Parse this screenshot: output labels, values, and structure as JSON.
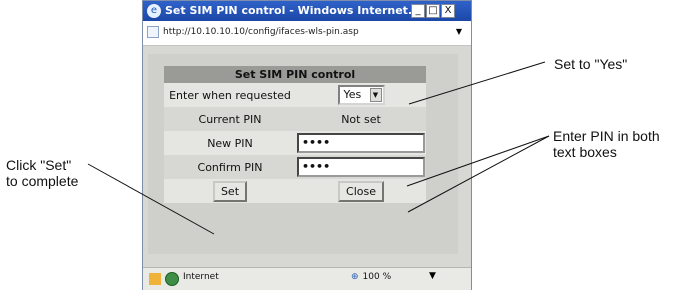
{
  "window": {
    "title": "Set SIM PIN control - Windows Internet...",
    "controls": {
      "minimize": "_",
      "maximize": "□",
      "close": "X"
    }
  },
  "address_bar": {
    "url": "http://10.10.10.10/config/ifaces-wls-pin.asp",
    "dropdown": "▼"
  },
  "form": {
    "title": "Set SIM PIN control",
    "rows": {
      "enter_when_requested": {
        "label": "Enter when requested",
        "value": "Yes"
      },
      "current_pin": {
        "label": "Current PIN",
        "value": "Not set"
      },
      "new_pin": {
        "label": "New PIN",
        "value": "••••"
      },
      "confirm_pin": {
        "label": "Confirm PIN",
        "value": "••••"
      }
    },
    "buttons": {
      "set": "Set",
      "close": "Close"
    }
  },
  "status_bar": {
    "zone": "Internet",
    "zoom": "100 %",
    "zoom_dropdown": "▼"
  },
  "annotations": {
    "set_to_yes": "Set to \"Yes\"",
    "enter_pin": [
      "Enter PIN in both",
      "text boxes"
    ],
    "click_set": [
      "Click \"Set\"",
      "to complete"
    ]
  }
}
